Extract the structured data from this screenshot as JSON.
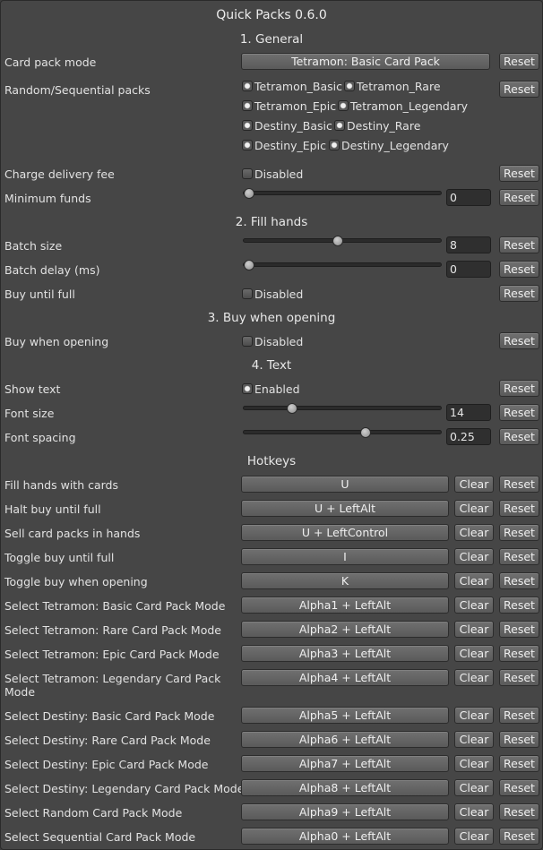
{
  "title": "Quick Packs 0.6.0",
  "sections": {
    "general": "1. General",
    "fill_hands": "2. Fill hands",
    "buy_when_opening": "3. Buy when opening",
    "text": "4. Text",
    "hotkeys": "Hotkeys"
  },
  "common": {
    "reset": "Reset",
    "clear": "Clear",
    "disabled": "Disabled",
    "enabled": "Enabled"
  },
  "general": {
    "card_pack_mode": {
      "label": "Card pack mode",
      "value": "Tetramon: Basic Card Pack"
    },
    "random_sequential": {
      "label": "Random/Sequential packs",
      "packs": [
        "Tetramon_Basic",
        "Tetramon_Rare",
        "Tetramon_Epic",
        "Tetramon_Legendary",
        "Destiny_Basic",
        "Destiny_Rare",
        "Destiny_Epic",
        "Destiny_Legendary"
      ]
    },
    "charge_delivery_fee": {
      "label": "Charge delivery fee",
      "state": "Disabled"
    },
    "minimum_funds": {
      "label": "Minimum funds",
      "value": "0",
      "level": 0
    }
  },
  "fill_hands": {
    "batch_size": {
      "label": "Batch size",
      "value": "8",
      "level": 0.47
    },
    "batch_delay": {
      "label": "Batch delay (ms)",
      "value": "0",
      "level": 0
    },
    "buy_until_full": {
      "label": "Buy until full",
      "state": "Disabled"
    }
  },
  "buy_when_opening": {
    "label": "Buy when opening",
    "state": "Disabled"
  },
  "text": {
    "show_text": {
      "label": "Show text",
      "state": "Enabled"
    },
    "font_size": {
      "label": "Font size",
      "value": "14",
      "level": 0.23
    },
    "font_spacing": {
      "label": "Font spacing",
      "value": "0.25",
      "level": 0.62
    }
  },
  "hotkeys": [
    {
      "label": "Fill hands with cards",
      "key": "U"
    },
    {
      "label": "Halt buy until full",
      "key": "U + LeftAlt"
    },
    {
      "label": "Sell card packs in hands",
      "key": "U + LeftControl"
    },
    {
      "label": "Toggle buy until full",
      "key": "I"
    },
    {
      "label": "Toggle buy when opening",
      "key": "K"
    },
    {
      "label": "Select Tetramon: Basic Card Pack Mode",
      "key": "Alpha1 + LeftAlt"
    },
    {
      "label": "Select Tetramon: Rare Card Pack Mode",
      "key": "Alpha2 + LeftAlt"
    },
    {
      "label": "Select Tetramon: Epic Card Pack Mode",
      "key": "Alpha3 + LeftAlt"
    },
    {
      "label": "Select Tetramon: Legendary Card Pack Mode",
      "key": "Alpha4 + LeftAlt"
    },
    {
      "label": "Select Destiny: Basic Card Pack Mode",
      "key": "Alpha5 + LeftAlt"
    },
    {
      "label": "Select Destiny: Rare Card Pack Mode",
      "key": "Alpha6 + LeftAlt"
    },
    {
      "label": "Select Destiny: Epic Card Pack Mode",
      "key": "Alpha7 + LeftAlt"
    },
    {
      "label": "Select Destiny: Legendary Card Pack Mode",
      "key": "Alpha8 + LeftAlt"
    },
    {
      "label": "Select Random Card Pack Mode",
      "key": "Alpha9 + LeftAlt"
    },
    {
      "label": "Select Sequential Card Pack Mode",
      "key": "Alpha0 + LeftAlt"
    }
  ]
}
